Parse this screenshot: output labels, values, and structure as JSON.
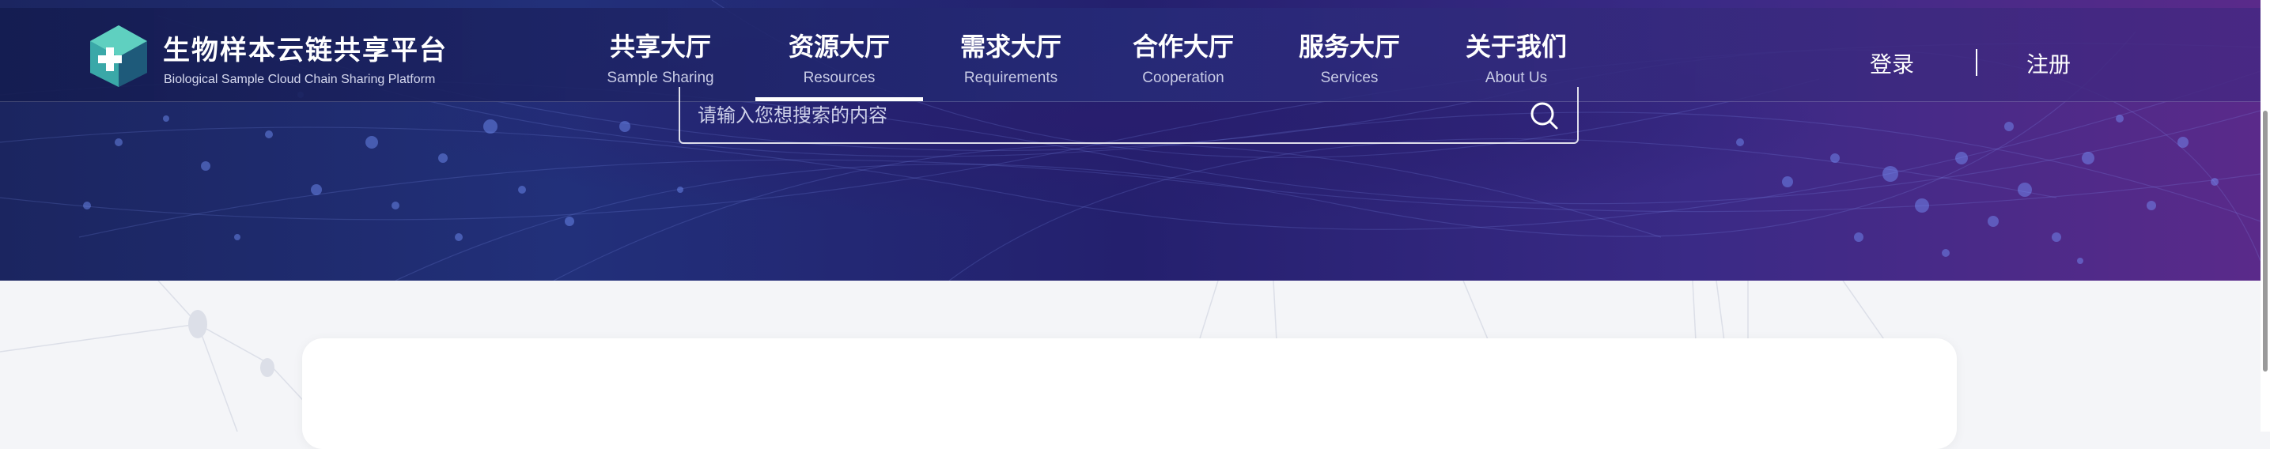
{
  "brand": {
    "name_cn": "生物样本云链共享平台",
    "name_en": "Biological Sample Cloud Chain Sharing Platform"
  },
  "nav": {
    "items": [
      {
        "cn": "共享大厅",
        "en": "Sample Sharing"
      },
      {
        "cn": "资源大厅",
        "en": "Resources",
        "active": true
      },
      {
        "cn": "需求大厅",
        "en": "Requirements"
      },
      {
        "cn": "合作大厅",
        "en": "Cooperation"
      },
      {
        "cn": "服务大厅",
        "en": "Services"
      },
      {
        "cn": "关于我们",
        "en": "About Us"
      }
    ]
  },
  "auth": {
    "login": "登录",
    "register": "注册"
  },
  "search": {
    "placeholder": "请输入您想搜索的内容"
  },
  "icons": {
    "logo": "cube-plus-logo-icon",
    "search": "search-icon"
  },
  "colors": {
    "header_dark": "#1b2560",
    "header_purple": "#5a2a8a",
    "page_bg": "#f4f5f8",
    "card_bg": "#ffffff"
  }
}
